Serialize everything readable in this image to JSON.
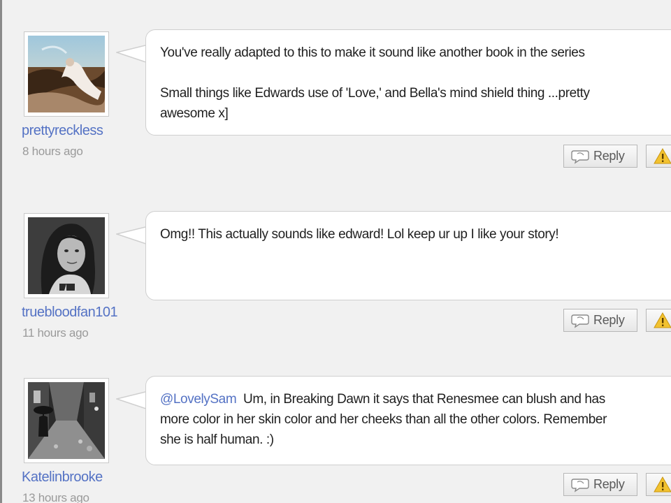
{
  "comments": [
    {
      "username": "prettyreckless",
      "time": "8 hours ago",
      "text": "You've really adapted to this to make it sound like another book in the series\n\nSmall things like Edwards use of 'Love,' and Bella's mind shield thing ...pretty\nawesome x]",
      "mention": "",
      "reply_label": "Reply",
      "avatar_icon": "avatar-photo-beach",
      "flag_icon": "warning-icon"
    },
    {
      "username": "truebloodfan101",
      "time": "11 hours ago",
      "text": "Omg!! This actually sounds like edward! Lol keep ur up I like your story!",
      "mention": "",
      "reply_label": "Reply",
      "avatar_icon": "avatar-photo-portrait",
      "flag_icon": "warning-icon"
    },
    {
      "username": "Katelinbrooke",
      "time": "13 hours ago",
      "mention": "@LovelySam",
      "text": "  Um, in Breaking Dawn it says that Renesmee can blush and has\nmore color in her skin color and her cheeks than all the other colors. Remember\nshe is half human. :)",
      "reply_label": "Reply",
      "avatar_icon": "avatar-photo-rainy-street",
      "flag_icon": "warning-icon"
    }
  ],
  "colors": {
    "link": "#5472c4",
    "timestamp": "#9a9a9a",
    "bubble_border": "#cfcfcf",
    "background": "#f1f1f1",
    "warning": "#f2c230"
  }
}
